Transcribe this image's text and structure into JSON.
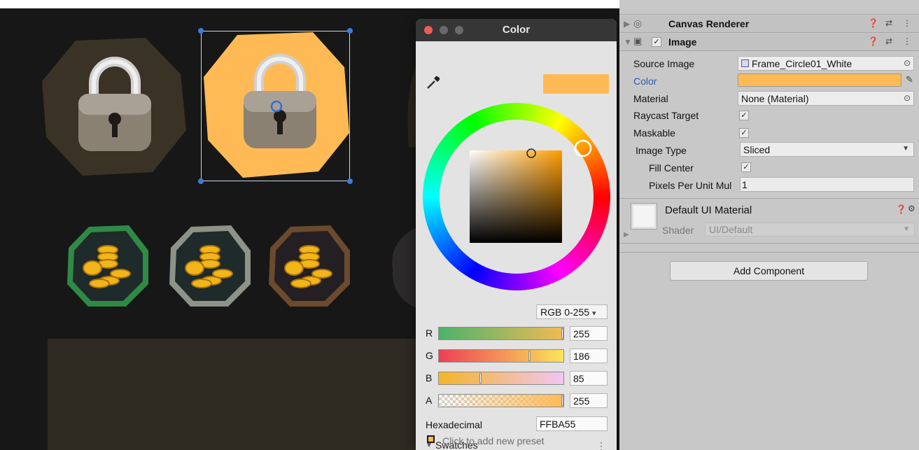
{
  "scene": {
    "colors": {
      "selected_frame": "#FFBA55",
      "locked_frame": "#3a3224",
      "banner": "#2f2b22"
    },
    "icons": [
      "lock-icon",
      "coins-icon"
    ]
  },
  "picker": {
    "title": "Color",
    "eyedropper_icon": "eyedropper-icon",
    "preview_color": "#FFBA55",
    "mode": "RGB 0-255",
    "mode_arrow": "▾",
    "channels": [
      {
        "label": "R",
        "value": "255",
        "fraction": 1.0
      },
      {
        "label": "G",
        "value": "186",
        "fraction": 0.729
      },
      {
        "label": "B",
        "value": "85",
        "fraction": 0.333
      },
      {
        "label": "A",
        "value": "255",
        "fraction": 1.0
      }
    ],
    "hex_label": "Hexadecimal",
    "hex_value": "FFBA55",
    "swatches_label": "Swatches",
    "swatches_toggle": "▼",
    "swatches_menu": "⋮",
    "add_preset": "Click to add new preset"
  },
  "inspector": {
    "canvas_renderer": {
      "title": "Canvas Renderer"
    },
    "image": {
      "title": "Image",
      "enabled": "✓",
      "source_image_label": "Source Image",
      "source_image_value": "Frame_Circle01_White",
      "color_label": "Color",
      "color_value": "#FFBA55",
      "material_label": "Material",
      "material_value": "None (Material)",
      "raycast_label": "Raycast Target",
      "raycast_checked": "✓",
      "maskable_label": "Maskable",
      "maskable_checked": "✓",
      "image_type_label": "Image Type",
      "image_type_value": "Sliced",
      "fill_center_label": "Fill Center",
      "fill_center_checked": "✓",
      "ppu_label": "Pixels Per Unit Mul",
      "ppu_value": "1"
    },
    "material": {
      "title": "Default UI Material",
      "shader_label": "Shader",
      "shader_value": "UI/Default"
    },
    "add_component_label": "Add Component",
    "header_icons": {
      "help": "help-icon",
      "presets": "presets-icon",
      "menu": "kebab-menu-icon"
    }
  }
}
